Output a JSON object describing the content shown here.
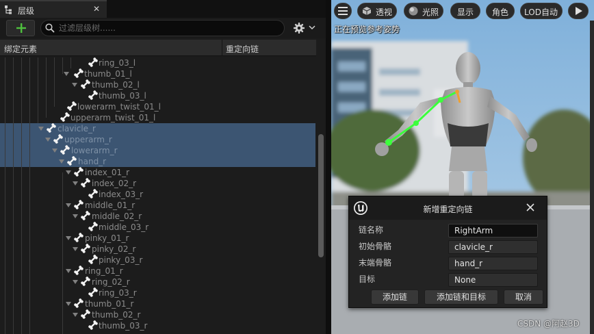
{
  "hierarchy": {
    "tab_title": "层级",
    "tab_close": "✕",
    "search_placeholder": "过滤层级树......",
    "columns": {
      "bound_element": "绑定元素",
      "retarget_chain": "重定向链"
    },
    "rows": [
      {
        "label": "ring_03_l"
      },
      {
        "label": "thumb_01_l"
      },
      {
        "label": "thumb_02_l"
      },
      {
        "label": "thumb_03_l"
      },
      {
        "label": "lowerarm_twist_01_l"
      },
      {
        "label": "upperarm_twist_01_l"
      },
      {
        "label": "clavicle_r"
      },
      {
        "label": "upperarm_r"
      },
      {
        "label": "lowerarm_r"
      },
      {
        "label": "hand_r"
      },
      {
        "label": "index_01_r"
      },
      {
        "label": "index_02_r"
      },
      {
        "label": "index_03_r"
      },
      {
        "label": "middle_01_r"
      },
      {
        "label": "middle_02_r"
      },
      {
        "label": "middle_03_r"
      },
      {
        "label": "pinky_01_r"
      },
      {
        "label": "pinky_02_r"
      },
      {
        "label": "pinky_03_r"
      },
      {
        "label": "ring_01_r"
      },
      {
        "label": "ring_02_r"
      },
      {
        "label": "ring_03_r"
      },
      {
        "label": "thumb_01_r"
      },
      {
        "label": "thumb_02_r"
      },
      {
        "label": "thumb_03_r"
      }
    ]
  },
  "viewport": {
    "buttons": {
      "menu_icon": "hamburger-icon",
      "perspective": "透视",
      "lighting": "光照",
      "show": "显示",
      "character": "角色",
      "lod": "LOD自动"
    },
    "caption": "正在预览参考姿势"
  },
  "dialog": {
    "title": "新增重定向链",
    "fields": {
      "chain_name_label": "链名称",
      "chain_name_value": "RightArm",
      "start_bone_label": "初始骨骼",
      "start_bone_value": "clavicle_r",
      "end_bone_label": "末端骨骼",
      "end_bone_value": "hand_r",
      "goal_label": "目标",
      "goal_value": "None"
    },
    "buttons": {
      "add_chain": "添加链",
      "add_chain_and_goal": "添加链和目标",
      "cancel": "取消"
    }
  },
  "watermark": "CSDN @阿赵3D",
  "colors": {
    "selection": "#3c5572",
    "chain_highlight": "#3cff3c",
    "accent_add": "#4fc13e"
  }
}
